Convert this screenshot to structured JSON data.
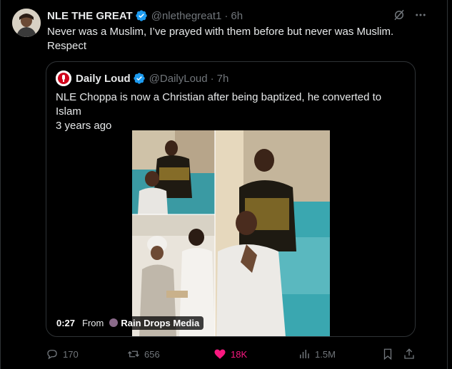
{
  "tweet": {
    "author_name": "NLE THE GREAT",
    "handle": "@nlethegreat1",
    "separator": "·",
    "time": "6h",
    "text": "Never was a Muslim, I’ve prayed with them before but never was Muslim.\nRespect"
  },
  "quote": {
    "author_name": "Daily Loud",
    "handle": "@DailyLoud",
    "separator": "·",
    "time": "7h",
    "text": "NLE Choppa is now a Christian after being baptized, he converted to Islam\n3 years ago",
    "media": {
      "duration": "0:27",
      "from_label": "From",
      "source": "Rain Drops Media"
    }
  },
  "actions": {
    "replies": "170",
    "reposts": "656",
    "likes": "18K",
    "views": "1.5M"
  },
  "colors": {
    "background": "#000000",
    "verified": "#1d9bf0",
    "like_active": "#f91880",
    "muted": "#71767b",
    "border": "#2f3336"
  },
  "icons": [
    "verified-badge-icon",
    "grok-icon",
    "more-icon",
    "reply-icon",
    "repost-icon",
    "heart-icon",
    "views-icon",
    "bookmark-icon",
    "share-icon"
  ]
}
